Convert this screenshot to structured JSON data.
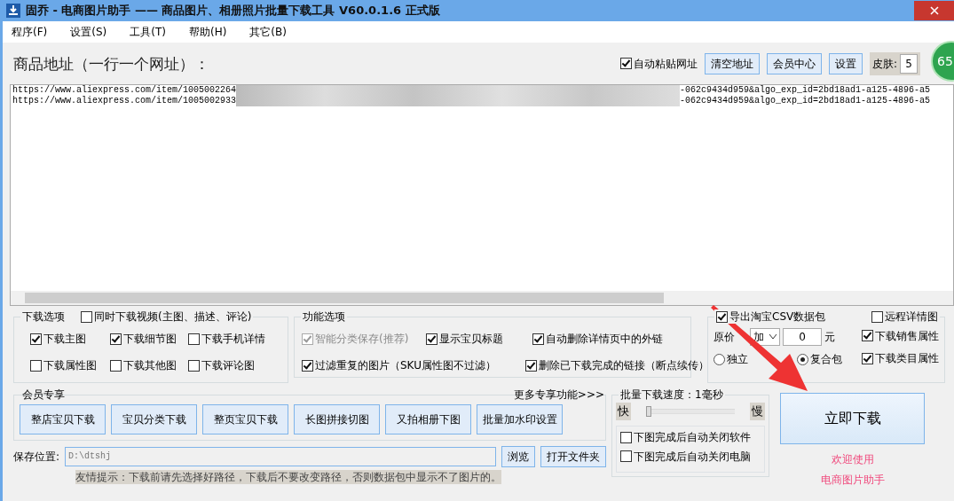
{
  "window": {
    "title": "固乔 - 电商图片助手 —— 商品图片、相册照片批量下载工具 V60.0.1.6 正式版"
  },
  "menu": [
    {
      "label": "程序(F)"
    },
    {
      "label": "设置(S)"
    },
    {
      "label": "工具(T)"
    },
    {
      "label": "帮助(H)"
    },
    {
      "label": "其它(B)"
    }
  ],
  "url_panel": {
    "label": "商品地址（一行一个网址）：",
    "auto_paste": {
      "label": "自动粘贴网址",
      "checked": true
    },
    "buttons": [
      "清空地址",
      "会员中心",
      "设置"
    ],
    "skin_label": "皮肤:",
    "skin_value": "5"
  },
  "percent_badge": "65",
  "urls": [
    {
      "start": "https://www.aliexpress.com/item/1005002264",
      "end": "-062c9434d959&algo_exp_id=2bd18ad1-a125-4896-a5"
    },
    {
      "start": "https://www.aliexpress.com/item/1005002933",
      "end": "-062c9434d959&algo_exp_id=2bd18ad1-a125-4896-a5"
    }
  ],
  "download_options": {
    "title": "下载选项",
    "video": {
      "label": "同时下载视频(主图、描述、评论)",
      "checked": false
    },
    "items": [
      {
        "label": "下载主图",
        "checked": true
      },
      {
        "label": "下载细节图",
        "checked": true
      },
      {
        "label": "下载手机详情",
        "checked": false
      },
      {
        "label": "下载属性图",
        "checked": false
      },
      {
        "label": "下载其他图",
        "checked": false
      },
      {
        "label": "下载评论图",
        "checked": false
      }
    ]
  },
  "function_options": {
    "title": "功能选项",
    "items": [
      {
        "label": "智能分类保存(推荐)",
        "checked": true,
        "disabled": true
      },
      {
        "label": "显示宝贝标题",
        "checked": true,
        "disabled": false
      },
      {
        "label": "自动删除详情页中的外链",
        "checked": true,
        "disabled": false
      },
      {
        "label": "过滤重复的图片（SKU属性图不过滤）",
        "checked": true,
        "disabled": false
      },
      {
        "label": "删除已下载完成的链接（断点续传）",
        "checked": true,
        "disabled": false
      }
    ]
  },
  "export": {
    "csv": {
      "label": "导出淘宝CSV数据包",
      "checked": true
    },
    "remote": {
      "label": "远程详情图",
      "checked": false
    },
    "price_label": "原价",
    "price_op": "加",
    "price_value": "0",
    "unit": "元",
    "packages": [
      {
        "label": "独立",
        "selected": false
      },
      {
        "label": "复合包",
        "selected": true
      }
    ],
    "attrs": [
      {
        "label": "下载销售属性",
        "checked": true
      },
      {
        "label": "下载类目属性",
        "checked": true
      }
    ]
  },
  "member": {
    "title": "会员专享",
    "more": "更多专享功能>>>",
    "buttons": [
      "整店宝贝下载",
      "宝贝分类下载",
      "整页宝贝下载",
      "长图拼接切图",
      "又拍相册下图",
      "批量加水印设置"
    ]
  },
  "save": {
    "label": "保存位置:",
    "value": "D:\\dtshj",
    "buttons": [
      "浏览",
      "打开文件夹"
    ],
    "hint": "友情提示：下载前请先选择好路径，下载后不要改变路径，否则数据包中显示不了图片的。"
  },
  "speed": {
    "label": "批量下载速度：1毫秒",
    "fast": "快",
    "slow": "慢",
    "level": 0,
    "options": [
      {
        "label": "下图完成后自动关闭软件",
        "checked": false
      },
      {
        "label": "下图完成后自动关闭电脑",
        "checked": false
      }
    ]
  },
  "download_button": "立即下载",
  "welcome": [
    "欢迎使用",
    "电商图片助手"
  ]
}
